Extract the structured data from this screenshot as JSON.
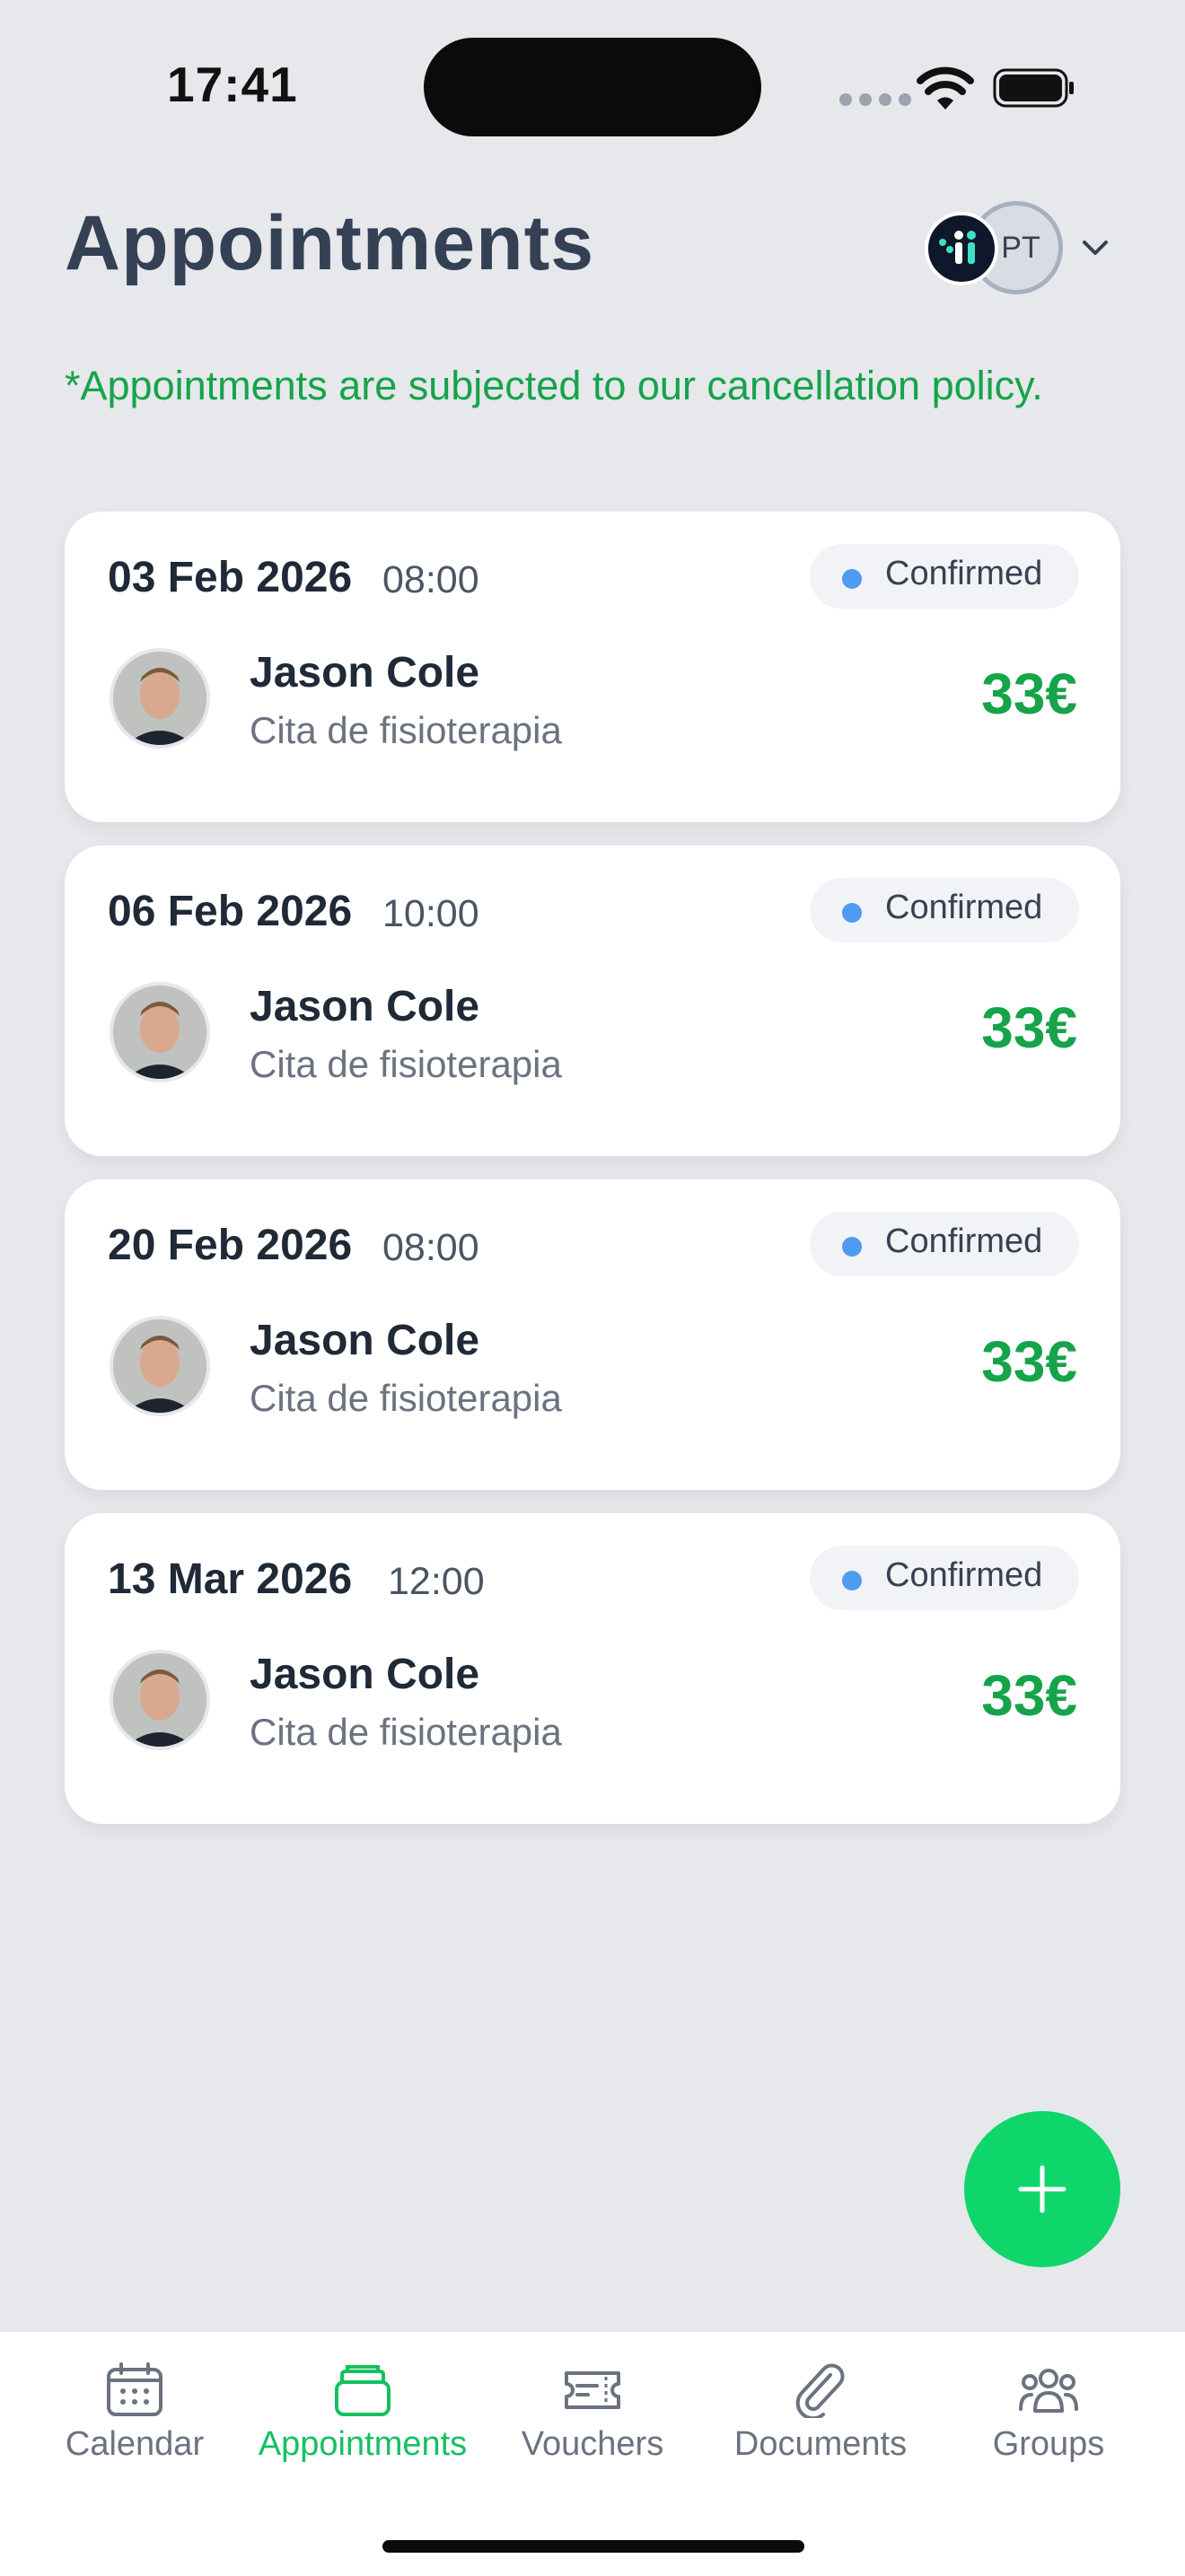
{
  "status_bar": {
    "time": "17:41"
  },
  "header": {
    "title": "Appointments",
    "account_initials": "PT"
  },
  "policy_note": "*Appointments are subjected to our cancellation policy.",
  "appointments": [
    {
      "date": "03 Feb 2026",
      "time": "08:00",
      "status": "Confirmed",
      "person": "Jason Cole",
      "service": "Cita de fisioterapia",
      "price": "33€"
    },
    {
      "date": "06 Feb 2026",
      "time": "10:00",
      "status": "Confirmed",
      "person": "Jason Cole",
      "service": "Cita de fisioterapia",
      "price": "33€"
    },
    {
      "date": "20 Feb 2026",
      "time": "08:00",
      "status": "Confirmed",
      "person": "Jason Cole",
      "service": "Cita de fisioterapia",
      "price": "33€"
    },
    {
      "date": "13 Mar 2026",
      "time": "12:00",
      "status": "Confirmed",
      "person": "Jason Cole",
      "service": "Cita de fisioterapia",
      "price": "33€"
    }
  ],
  "tab_bar": {
    "tabs": [
      {
        "label": "Calendar",
        "icon": "calendar-icon",
        "active": false
      },
      {
        "label": "Appointments",
        "icon": "appointments-icon",
        "active": true
      },
      {
        "label": "Vouchers",
        "icon": "ticket-icon",
        "active": false
      },
      {
        "label": "Documents",
        "icon": "paperclip-icon",
        "active": false
      },
      {
        "label": "Groups",
        "icon": "groups-icon",
        "active": false
      }
    ]
  },
  "colors": {
    "accent_green": "#16A34A",
    "fab_green": "#0ED66A",
    "status_dot": "#4F9BF0",
    "background": "#E6E8EC"
  }
}
